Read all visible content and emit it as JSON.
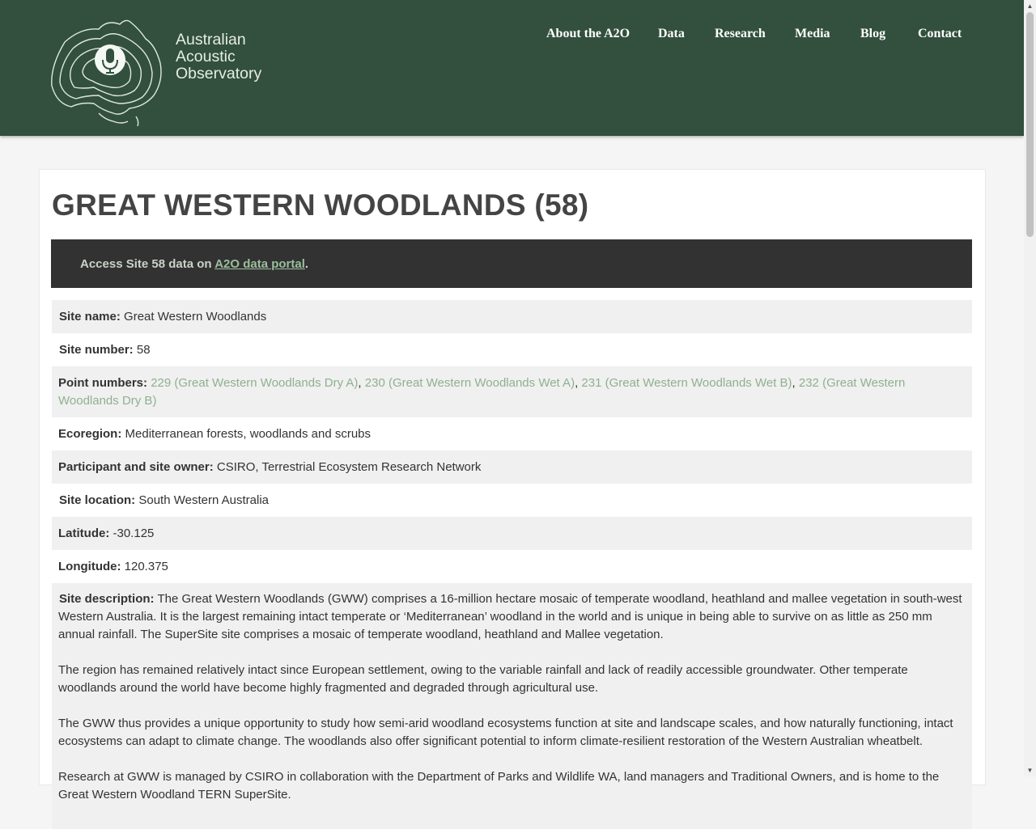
{
  "header": {
    "logo_lines": [
      "Australian",
      "Acoustic",
      "Observatory"
    ],
    "nav": [
      {
        "label": "About the A2O"
      },
      {
        "label": "Data"
      },
      {
        "label": "Research"
      },
      {
        "label": "Media"
      },
      {
        "label": "Blog"
      },
      {
        "label": "Contact"
      }
    ]
  },
  "page": {
    "title": "GREAT WESTERN WOODLANDS (58)",
    "notice_prefix": "Access Site 58 data on ",
    "notice_link": "A2O data portal",
    "notice_suffix": "."
  },
  "details": {
    "site_name": {
      "label": "Site name:",
      "value": "Great Western Woodlands"
    },
    "site_number": {
      "label": "Site number:",
      "value": "58"
    },
    "point_numbers": {
      "label": "Point numbers:",
      "points": [
        "229 (Great Western Woodlands Dry A)",
        "230 (Great Western Woodlands Wet A)",
        "231 (Great Western Woodlands Wet B)",
        "232 (Great Western Woodlands Dry B)"
      ],
      "separator": ", "
    },
    "ecoregion": {
      "label": "Ecoregion:",
      "value": "Mediterranean forests, woodlands and scrubs"
    },
    "participant": {
      "label": "Participant and site owner:",
      "value": "CSIRO, Terrestrial Ecosystem Research Network"
    },
    "site_location": {
      "label": "Site location:",
      "value": "South Western Australia"
    },
    "latitude": {
      "label": "Latitude:",
      "value": "-30.125"
    },
    "longitude": {
      "label": "Longitude:",
      "value": "120.375"
    },
    "description": {
      "label": "Site description:",
      "paragraphs": [
        "The Great Western Woodlands (GWW) comprises a 16-million hectare mosaic of temperate woodland, heathland and mallee vegetation in south-west Western Australia. It is the largest remaining intact temperate or ‘Mediterranean’ woodland in the world and is unique in being able to survive on as little as 250 mm annual rainfall. The SuperSite site comprises a mosaic of temperate woodland, heathland and Mallee vegetation.",
        "The region has remained relatively intact since European settlement, owing to the variable rainfall and lack of readily accessible groundwater. Other temperate woodlands around the world have become highly fragmented and degraded through agricultural use.",
        "The GWW thus provides a unique opportunity to study how semi-arid woodland ecosystems function at site and landscape scales, and how naturally functioning, intact ecosystems can adapt to climate change. The woodlands also offer significant potential to inform climate-resilient restoration of the Western Australian wheatbelt.",
        "Research at GWW is managed by CSIRO in collaboration with the Department of Parks and Wildlife WA, land managers and Traditional Owners, and is home to the Great Western Woodland TERN SuperSite."
      ]
    }
  },
  "colors": {
    "header_bg": "#32503d",
    "notice_bg": "#323232",
    "link": "#8fb08f",
    "row_alt": "#f0f0f0"
  },
  "icons": {
    "logo": "australia-map-microphone-icon",
    "scroll_up": "chevron-up-icon",
    "scroll_down": "chevron-down-icon"
  }
}
